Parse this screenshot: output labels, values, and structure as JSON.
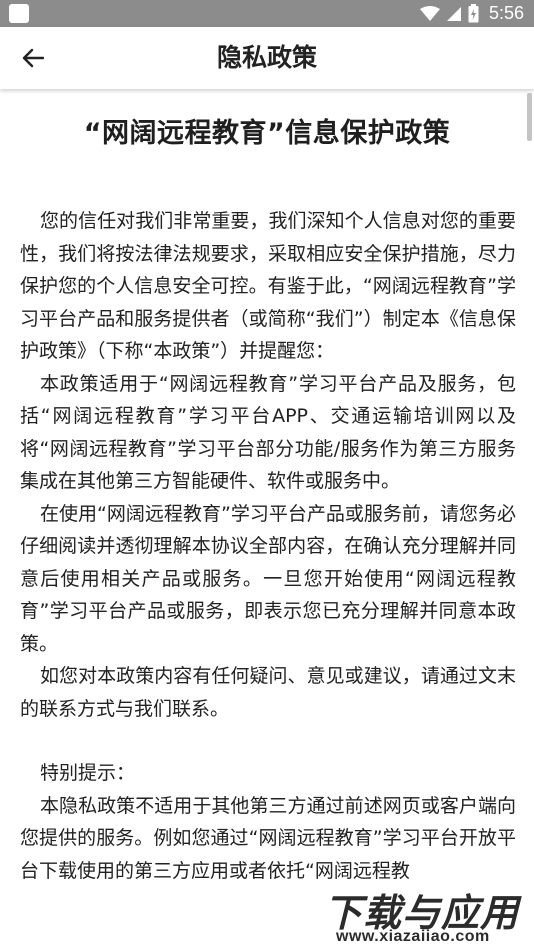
{
  "status_bar": {
    "time": "5:56",
    "icons": [
      "app-notification-icon",
      "wifi-icon",
      "signal-icon",
      "battery-icon"
    ]
  },
  "app_bar": {
    "back_icon": "arrow-left-icon",
    "title": "隐私政策"
  },
  "document": {
    "title": "“网阔远程教育”信息保护政策",
    "paragraphs": [
      "您的信任对我们非常重要，我们深知个人信息对您的重要性，我们将按法律法规要求，采取相应安全保护措施，尽力保护您的个人信息安全可控。有鉴于此，“网阔远程教育”学习平台产品和服务提供者（或简称“我们”）制定本《信息保护政策》（下称“本政策”）并提醒您：",
      "本政策适用于“网阔远程教育”学习平台产品及服务，包括“网阔远程教育”学习平台APP、交通运输培训网以及将“网阔远程教育”学习平台部分功能/服务作为第三方服务集成在其他第三方智能硬件、软件或服务中。",
      "在使用“网阔远程教育”学习平台产品或服务前，请您务必仔细阅读并透彻理解本协议全部内容，在确认充分理解并同意后使用相关产品或服务。一旦您开始使用“网阔远程教育”学习平台产品或服务，即表示您已充分理解并同意本政策。",
      "如您对本政策内容有任何疑问、意见或建议，请通过文末的联系方式与我们联系。"
    ],
    "special_heading": "特别提示：",
    "special_paragraph": "本隐私政策不适用于其他第三方通过前述网页或客户端向您提供的服务。例如您通过“网阔远程教育”学习平台开放平台下载使用的第三方应用或者依托“网阔远程教"
  },
  "watermark": {
    "main": "下载与应用",
    "sub": "www.xiazaiiao.com"
  },
  "colors": {
    "status_bar": "#8c8c8c",
    "app_bar": "#ffffff",
    "text": "#222222",
    "background": "#ffffff"
  }
}
